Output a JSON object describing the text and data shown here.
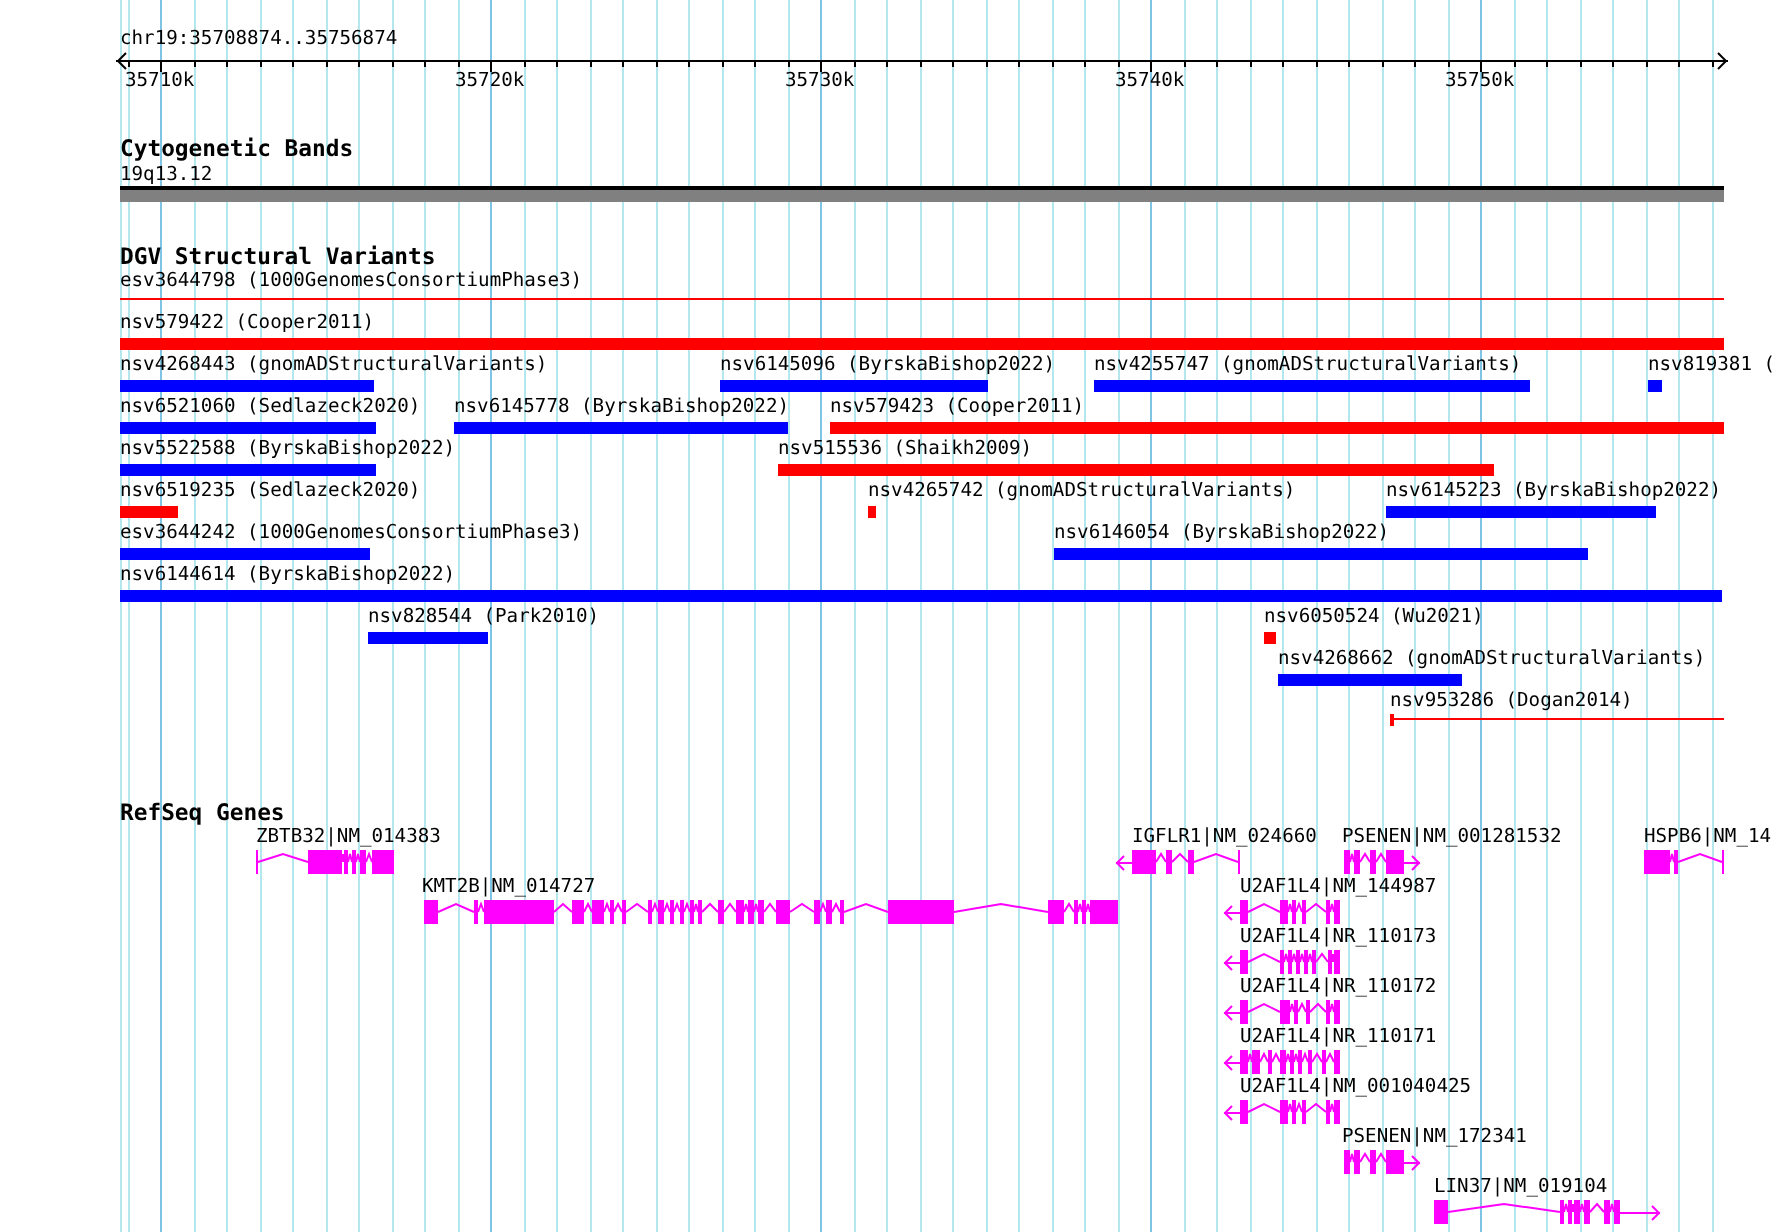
{
  "ruler": {
    "location": "chr19:35708874..35756874",
    "ticks": [
      "35710k",
      "35720k",
      "35730k",
      "35740k",
      "35750k"
    ]
  },
  "tracks": [
    {
      "title": "Cytogenetic Bands",
      "kind": "cytoband",
      "features": [
        {
          "label": "19q13.12"
        }
      ]
    },
    {
      "title": "DGV Structural Variants",
      "kind": "variants",
      "features": [
        {
          "label": "esv3644798 (1000GenomesConsortiumPhase3)",
          "color": "#ff0000",
          "kind": "line"
        },
        {
          "label": "nsv579422 (Cooper2011)",
          "color": "#ff0000",
          "kind": "bar"
        },
        {
          "label": "nsv4268443 (gnomADStructuralVariants)",
          "color": "#0000ff",
          "kind": "bar"
        },
        {
          "label": "nsv6145096 (ByrskaBishop2022)",
          "color": "#0000ff",
          "kind": "bar"
        },
        {
          "label": "nsv4255747 (gnomADStructuralVariants)",
          "color": "#0000ff",
          "kind": "bar"
        },
        {
          "label": "nsv819381 (",
          "color": "#0000ff",
          "kind": "bar"
        },
        {
          "label": "nsv6521060 (Sedlazeck2020)",
          "color": "#0000ff",
          "kind": "bar"
        },
        {
          "label": "nsv6145778 (ByrskaBishop2022)",
          "color": "#0000ff",
          "kind": "bar"
        },
        {
          "label": "nsv579423 (Cooper2011)",
          "color": "#ff0000",
          "kind": "bar"
        },
        {
          "label": "nsv5522588 (ByrskaBishop2022)",
          "color": "#0000ff",
          "kind": "bar"
        },
        {
          "label": "nsv515536 (Shaikh2009)",
          "color": "#ff0000",
          "kind": "bar"
        },
        {
          "label": "nsv6519235 (Sedlazeck2020)",
          "color": "#ff0000",
          "kind": "bar"
        },
        {
          "label": "nsv4265742 (gnomADStructuralVariants)",
          "color": "#ff0000",
          "kind": "bar"
        },
        {
          "label": "nsv6145223 (ByrskaBishop2022)",
          "color": "#0000ff",
          "kind": "bar"
        },
        {
          "label": "esv3644242 (1000GenomesConsortiumPhase3)",
          "color": "#0000ff",
          "kind": "bar"
        },
        {
          "label": "nsv6146054 (ByrskaBishop2022)",
          "color": "#0000ff",
          "kind": "bar"
        },
        {
          "label": "nsv6144614 (ByrskaBishop2022)",
          "color": "#0000ff",
          "kind": "bar"
        },
        {
          "label": "nsv828544 (Park2010)",
          "color": "#0000ff",
          "kind": "bar"
        },
        {
          "label": "nsv6050524 (Wu2021)",
          "color": "#ff0000",
          "kind": "bar"
        },
        {
          "label": "nsv4268662 (gnomADStructuralVariants)",
          "color": "#0000ff",
          "kind": "bar"
        },
        {
          "label": "nsv953286 (Dogan2014)",
          "color": "#ff0000",
          "kind": "line"
        }
      ]
    },
    {
      "title": "RefSeq Genes",
      "kind": "genes",
      "features": [
        {
          "label": "ZBTB32|NM_014383",
          "left_arrow": false,
          "right_arrow": false
        },
        {
          "label": "IGFLR1|NM_024660",
          "left_arrow": true,
          "right_arrow": false
        },
        {
          "label": "PSENEN|NM_001281532",
          "left_arrow": false,
          "right_arrow": true
        },
        {
          "label": "HSPB6|NM_14",
          "left_arrow": false,
          "right_arrow": false
        },
        {
          "label": "KMT2B|NM_014727",
          "left_arrow": false,
          "right_arrow": false
        },
        {
          "label": "U2AF1L4|NM_144987",
          "left_arrow": true,
          "right_arrow": false
        },
        {
          "label": "U2AF1L4|NR_110173",
          "left_arrow": true,
          "right_arrow": false
        },
        {
          "label": "U2AF1L4|NR_110172",
          "left_arrow": true,
          "right_arrow": false
        },
        {
          "label": "U2AF1L4|NR_110171",
          "left_arrow": true,
          "right_arrow": false
        },
        {
          "label": "U2AF1L4|NM_001040425",
          "left_arrow": true,
          "right_arrow": false
        },
        {
          "label": "PSENEN|NM_172341",
          "left_arrow": false,
          "right_arrow": true
        },
        {
          "label": "LIN37|NM_019104",
          "left_arrow": false,
          "right_arrow": true
        }
      ]
    }
  ]
}
